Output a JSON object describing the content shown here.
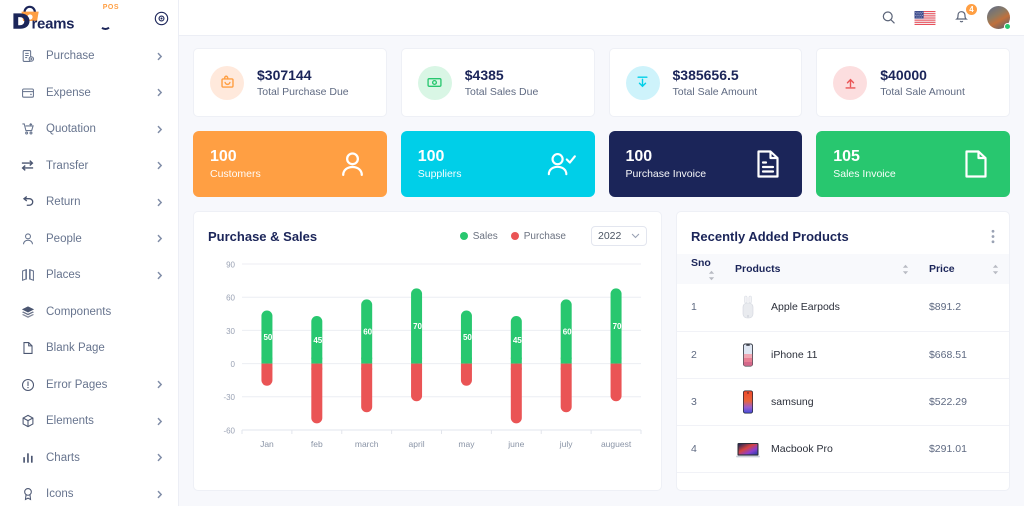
{
  "brand": {
    "name": "Dreams",
    "suffix": "POS"
  },
  "sidebar": {
    "collapse_icon": "circle-dot-icon",
    "items": [
      {
        "label": "Purchase",
        "icon": "purchase-icon",
        "arrow": true
      },
      {
        "label": "Expense",
        "icon": "wallet-icon",
        "arrow": true
      },
      {
        "label": "Quotation",
        "icon": "cart-icon",
        "arrow": true
      },
      {
        "label": "Transfer",
        "icon": "transfer-icon",
        "arrow": true
      },
      {
        "label": "Return",
        "icon": "return-icon",
        "arrow": true
      },
      {
        "label": "People",
        "icon": "user-icon",
        "arrow": true
      },
      {
        "label": "Places",
        "icon": "map-icon",
        "arrow": true
      },
      {
        "label": "Components",
        "icon": "layers-icon",
        "arrow": false
      },
      {
        "label": "Blank Page",
        "icon": "page-icon",
        "arrow": false
      },
      {
        "label": "Error Pages",
        "icon": "alert-circle-icon",
        "arrow": true
      },
      {
        "label": "Elements",
        "icon": "cube-icon",
        "arrow": true
      },
      {
        "label": "Charts",
        "icon": "bar-chart-icon",
        "arrow": true
      },
      {
        "label": "Icons",
        "icon": "award-icon",
        "arrow": true
      }
    ]
  },
  "topbar": {
    "search_icon": "search-icon",
    "flag": "us-flag-icon",
    "bell_icon": "bell-icon",
    "notification_count": "4",
    "avatar": "user-avatar",
    "status": "online"
  },
  "stats": [
    {
      "value": "$307144",
      "label": "Total Purchase Due",
      "icon": "bag-icon",
      "color": "#ff9f43",
      "bg": "#ffe9dc"
    },
    {
      "value": "$4385",
      "label": "Total Sales Due",
      "icon": "cash-icon",
      "color": "#28c76f",
      "bg": "#d9f6e5"
    },
    {
      "value": "$385656.5",
      "label": "Total Sale Amount",
      "icon": "arrow-down-icon",
      "color": "#00cfe8",
      "bg": "#cef3fb"
    },
    {
      "value": "$40000",
      "label": "Total Sale Amount",
      "icon": "arrow-up-icon",
      "color": "#ea5455",
      "bg": "#fcdedf"
    }
  ],
  "highlights": [
    {
      "value": "100",
      "label": "Customers",
      "bg": "#ff9f43",
      "icon": "person-icon"
    },
    {
      "value": "100",
      "label": "Suppliers",
      "bg": "#00cfe8",
      "icon": "person-check-icon"
    },
    {
      "value": "100",
      "label": "Purchase Invoice",
      "bg": "#1b2559",
      "icon": "invoice-lines-icon"
    },
    {
      "value": "105",
      "label": "Sales Invoice",
      "bg": "#28c76f",
      "icon": "file-icon"
    }
  ],
  "chart_panel": {
    "title": "Purchase & Sales",
    "legend": [
      {
        "label": "Sales",
        "color": "#28c76f"
      },
      {
        "label": "Purchase",
        "color": "#ea5455"
      }
    ],
    "year": "2022",
    "chevron": "chevron-down-icon"
  },
  "chart_data": {
    "type": "bar",
    "title": "Purchase & Sales",
    "categories": [
      "Jan",
      "feb",
      "march",
      "april",
      "may",
      "june",
      "july",
      "auguest"
    ],
    "series": [
      {
        "name": "Sales",
        "color": "#28c76f",
        "values": [
          48,
          43,
          58,
          68,
          48,
          43,
          58,
          68
        ],
        "labels": [
          "50",
          "45",
          "60",
          "70",
          "50",
          "45",
          "60",
          "70"
        ]
      },
      {
        "name": "Purchase",
        "color": "#ea5455",
        "values": [
          -20,
          -54,
          -44,
          -34,
          -20,
          -54,
          -44,
          -34
        ],
        "labels": [
          "",
          "",
          "",
          "",
          "",
          "",
          "",
          ""
        ]
      }
    ],
    "ylabel": "",
    "xlabel": "",
    "yticks": [
      90,
      60,
      30,
      0,
      -30,
      -60
    ],
    "ylim": [
      -60,
      90
    ],
    "grid": true,
    "legend_position": "top-right",
    "stacked": true
  },
  "products_panel": {
    "title": "Recently Added Products",
    "menu_icon": "kebab-menu-icon",
    "columns": [
      "Sno",
      "Products",
      "Price"
    ],
    "sort_icon": "sort-icon",
    "rows": [
      {
        "sno": "1",
        "product": "Apple Earpods",
        "price": "$891.2",
        "thumb": "earpods-thumb"
      },
      {
        "sno": "2",
        "product": "iPhone 11",
        "price": "$668.51",
        "thumb": "iphone-thumb"
      },
      {
        "sno": "3",
        "product": "samsung",
        "price": "$522.29",
        "thumb": "samsung-thumb"
      },
      {
        "sno": "4",
        "product": "Macbook Pro",
        "price": "$291.01",
        "thumb": "macbook-thumb"
      }
    ]
  }
}
